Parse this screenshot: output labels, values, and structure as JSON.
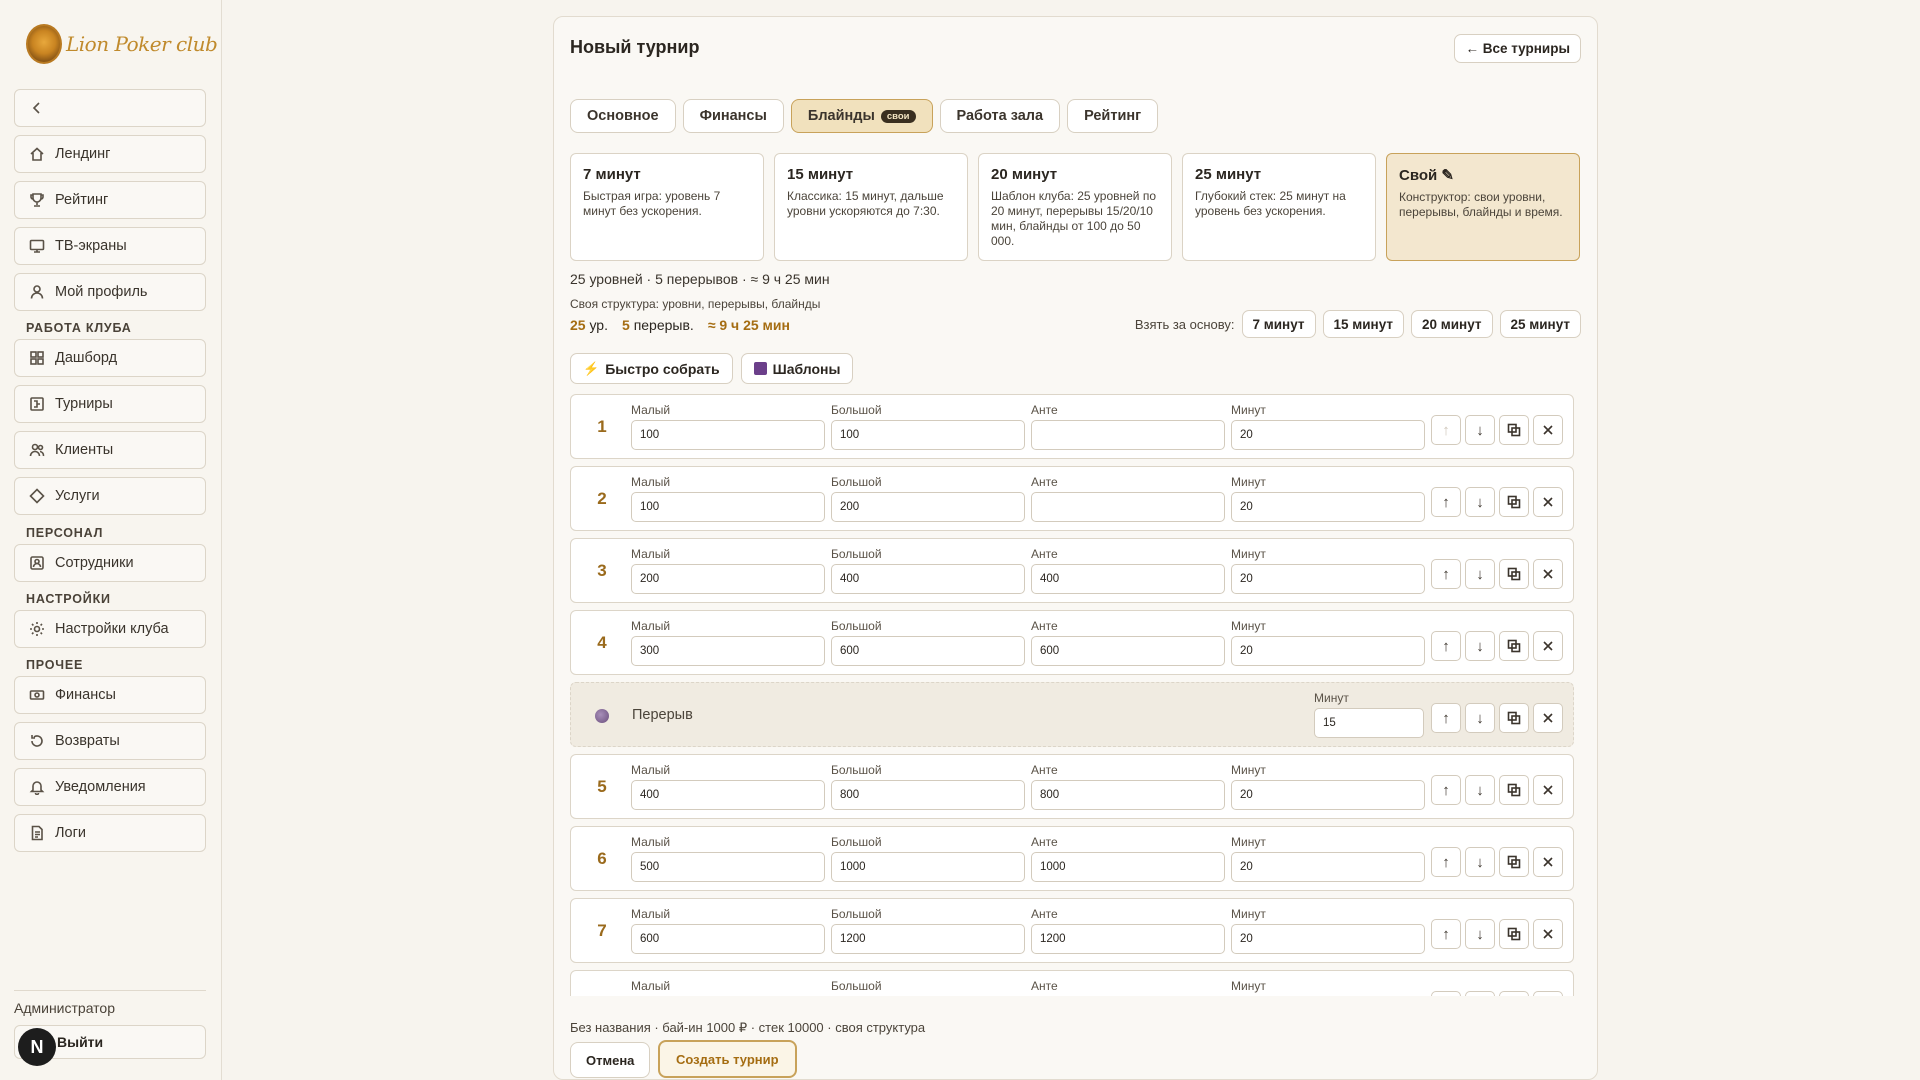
{
  "brand": {
    "name": "Lion Poker club"
  },
  "sidebar": {
    "items": [
      {
        "label": "Лендинг",
        "icon": "home-icon"
      },
      {
        "label": "Рейтинг",
        "icon": "trophy-icon"
      },
      {
        "label": "ТВ-экраны",
        "icon": "monitor-icon"
      },
      {
        "label": "Мой профиль",
        "icon": "user-icon"
      },
      {
        "label": "Дашборд",
        "icon": "grid-icon"
      },
      {
        "label": "Турниры",
        "icon": "tournament-icon"
      },
      {
        "label": "Клиенты",
        "icon": "users-icon"
      },
      {
        "label": "Услуги",
        "icon": "diamond-icon"
      },
      {
        "label": "Сотрудники",
        "icon": "staff-icon"
      },
      {
        "label": "Настройки клуба",
        "icon": "sun-gear-icon"
      },
      {
        "label": "Финансы",
        "icon": "cash-icon"
      },
      {
        "label": "Возвраты",
        "icon": "refresh-icon"
      },
      {
        "label": "Уведомления",
        "icon": "bell-icon"
      },
      {
        "label": "Логи",
        "icon": "file-icon"
      }
    ],
    "sections": {
      "club": "РАБОТА КЛУБА",
      "staff": "ПЕРСОНАЛ",
      "settings": "НАСТРОЙКИ",
      "other": "ПРОЧЕЕ"
    },
    "admin_label": "Администратор",
    "exit_label": "Выйти",
    "n_badge": "N"
  },
  "header": {
    "title": "Новый турнир",
    "all_button": "← Все турниры"
  },
  "tabs": [
    {
      "label": "Основное"
    },
    {
      "label": "Финансы"
    },
    {
      "label": "Блайнды",
      "badge": "свои"
    },
    {
      "label": "Работа зала"
    },
    {
      "label": "Рейтинг"
    }
  ],
  "presets": [
    {
      "title": "7 минут",
      "desc": "Быстрая игра: уровень 7 минут без ускорения."
    },
    {
      "title": "15 минут",
      "desc": "Классика: 15 минут, дальше уровни ускоряются до 7:30."
    },
    {
      "title": "20 минут",
      "desc": "Шаблон клуба: 25 уровней по 20 минут, перерывы 15/20/10 мин, блайнды от 100 до 50 000."
    },
    {
      "title": "25 минут",
      "desc": "Глубокий стек: 25 минут на уровень без ускорения."
    },
    {
      "title": "Свой ✎",
      "desc": "Конструктор: свои уровни, перерывы, блайнды и время."
    }
  ],
  "summary": {
    "line1": "25 уровней · 5 перерывов · ≈ 9 ч 25 мин",
    "line2": "Своя структура: уровни, перерывы, блайнды",
    "levels_num": "25",
    "levels_unit": "ур.",
    "breaks_num": "5",
    "breaks_unit": "перерыв.",
    "duration": "≈ 9 ч 25 мин"
  },
  "base": {
    "label": "Взять за основу:",
    "options": [
      "7 минут",
      "15 минут",
      "20 минут",
      "25 минут"
    ]
  },
  "tools": {
    "quick": "Быстро собрать",
    "templates": "Шаблоны"
  },
  "field_labels": {
    "small": "Малый",
    "big": "Большой",
    "ante": "Анте",
    "minutes": "Минут"
  },
  "levels": [
    {
      "num": "1",
      "small": "100",
      "big": "100",
      "ante": "",
      "minutes": "20"
    },
    {
      "num": "2",
      "small": "100",
      "big": "200",
      "ante": "",
      "minutes": "20"
    },
    {
      "num": "3",
      "small": "200",
      "big": "400",
      "ante": "400",
      "minutes": "20"
    },
    {
      "num": "4",
      "small": "300",
      "big": "600",
      "ante": "600",
      "minutes": "20"
    },
    {
      "break": true,
      "label": "Перерыв",
      "minutes": "15"
    },
    {
      "num": "5",
      "small": "400",
      "big": "800",
      "ante": "800",
      "minutes": "20"
    },
    {
      "num": "6",
      "small": "500",
      "big": "1000",
      "ante": "1000",
      "minutes": "20"
    },
    {
      "num": "7",
      "small": "600",
      "big": "1200",
      "ante": "1200",
      "minutes": "20"
    },
    {
      "num": "8",
      "small": "",
      "big": "",
      "ante": "",
      "minutes": ""
    }
  ],
  "footer": {
    "summary": "Без названия · бай-ин 1000 ₽ · стек 10000 · своя структура",
    "cancel": "Отмена",
    "create": "Создать турнир"
  }
}
